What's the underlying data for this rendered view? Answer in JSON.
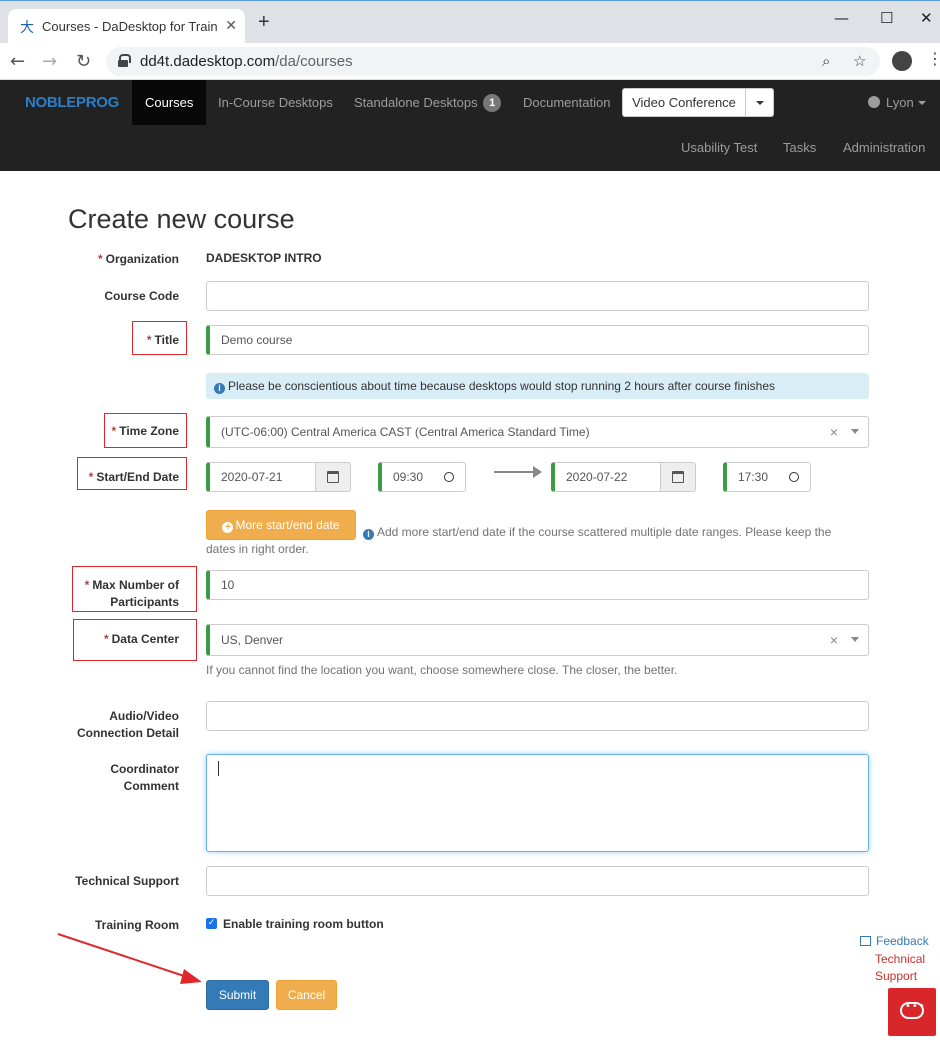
{
  "browser": {
    "tab_title": "Courses - DaDesktop for Train",
    "tab_favicon": "大",
    "url_host": "dd4t.dadesktop.com",
    "url_path": "/da/courses"
  },
  "navbar": {
    "brand": "NOBLEPROG",
    "items": [
      {
        "label": "Courses",
        "active": true
      },
      {
        "label": "In-Course Desktops"
      },
      {
        "label": "Standalone Desktops",
        "badge": "1"
      },
      {
        "label": "Documentation"
      }
    ],
    "video_conference": "Video Conference",
    "user": "Lyon",
    "secondary": [
      "Usability Test",
      "Tasks",
      "Administration"
    ]
  },
  "form": {
    "title": "Create new course",
    "organization_label": "Organization",
    "organization_value": "DADESKTOP INTRO",
    "course_code_label": "Course Code",
    "course_code_value": "",
    "title_label": "Title",
    "title_value": "Demo course",
    "info_text": "Please be conscientious about time because desktops would stop running 2 hours after course finishes",
    "timezone_label": "Time Zone",
    "timezone_value": "(UTC-06:00) Central America CAST (Central America Standard Time)",
    "startend_label": "Start/End Date",
    "start_date": "2020-07-21",
    "start_time": "09:30",
    "end_date": "2020-07-22",
    "end_time": "17:30",
    "more_dates_button": "More start/end date",
    "more_dates_help_1": "Add more start/end date if the course scattered multiple date ranges. Please keep the",
    "more_dates_help_2": "dates in right order.",
    "max_participants_label_1": "Max Number of",
    "max_participants_label_2": "Participants",
    "max_participants_value": "10",
    "datacenter_label": "Data Center",
    "datacenter_value": "US, Denver",
    "datacenter_help": "If you cannot find the location you want, choose somewhere close. The closer, the better.",
    "av_label_1": "Audio/Video",
    "av_label_2": "Connection Detail",
    "av_value": "",
    "coord_label_1": "Coordinator",
    "coord_label_2": "Comment",
    "coord_value": "",
    "tech_support_label": "Technical Support",
    "tech_support_value": "",
    "training_room_label": "Training Room",
    "training_room_checkbox": "Enable training room button",
    "training_room_checked": true,
    "submit": "Submit",
    "cancel": "Cancel",
    "required_mark": "*"
  },
  "widget": {
    "feedback": "Feedback",
    "technical_support_1": "Technical",
    "technical_support_2": "Support"
  },
  "colors": {
    "accent_primary": "#337ab7",
    "accent_warning": "#f0ad4e",
    "valid_green": "#3c9b45",
    "annotation_red": "#e0282a"
  }
}
